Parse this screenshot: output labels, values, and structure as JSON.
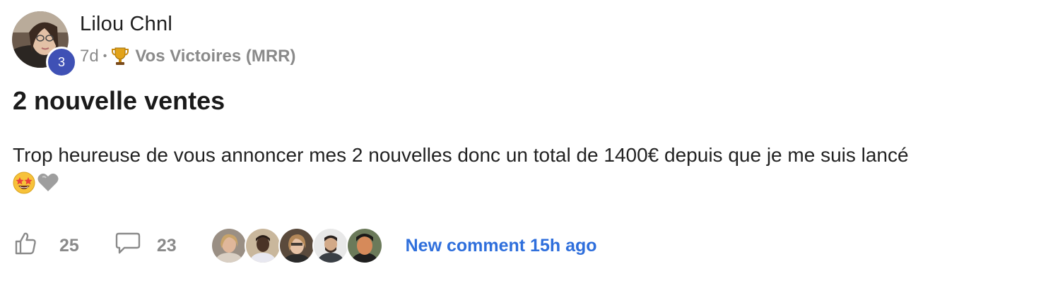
{
  "author": {
    "name": "Lilou Chnl",
    "level": "3",
    "avatar_icon": "user-avatar-photo"
  },
  "meta": {
    "time": "7d",
    "separator": "•",
    "category_icon": "trophy-icon",
    "category": "Vos Victoires (MRR)"
  },
  "post": {
    "title": "2 nouvelle ventes",
    "body": "Trop heureuse de vous annoncer mes 2 nouvelles donc un total de 1400€ depuis que je me suis lancé",
    "emojis": [
      "star-struck-emoji",
      "grey-heart-emoji"
    ]
  },
  "actions": {
    "likes": "25",
    "comments": "23",
    "like_icon": "thumbs-up-icon",
    "comment_icon": "comment-bubble-icon"
  },
  "commenters_count": 5,
  "new_comment": "New comment 15h ago",
  "colors": {
    "badge": "#3f51b5",
    "link": "#2f6fdc",
    "muted": "#8a8a8a"
  }
}
